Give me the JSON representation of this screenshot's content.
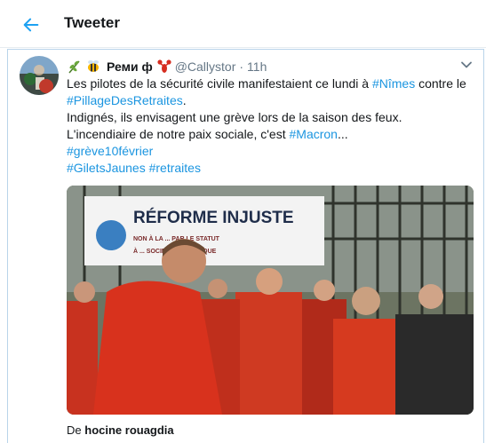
{
  "header": {
    "title": "Tweeter"
  },
  "tweet": {
    "emojis": [
      "herb-icon",
      "bee-icon",
      "lobster-icon"
    ],
    "display_name": "Реми ф",
    "handle": "@Callystor",
    "separator": "·",
    "time": "11h",
    "body": {
      "p1_a": "Les pilotes de la sécurité civile manifestaient ce lundi à ",
      "p1_tag1": "#Nîmes",
      "p1_b": " contre le ",
      "p1_tag2": "#PillageDesRetraites",
      "p1_c": ".",
      "p2": "Indignés, ils envisagent une grève lors de la saison des feux.",
      "p3_a": "L'incendiaire de notre paix sociale, c'est ",
      "p3_tag": "#Macron",
      "p3_b": "...",
      "tag_greve": "#grève10février",
      "tag_gilets": "#GiletsJaunes",
      "tag_retraites": "#retraites"
    },
    "media": {
      "banner_title": "RÉFORME INJUSTE",
      "banner_sub1": "NON À LA ... PAR LE STATUT",
      "banner_sub2": "À ... SOCIETE REPUBLIQUE"
    },
    "credit": {
      "prefix": "De",
      "author": "hocine rouagdia"
    }
  },
  "colors": {
    "link": "#1b95e0",
    "accent": "#1da1f2",
    "border": "#b9d4ea"
  }
}
